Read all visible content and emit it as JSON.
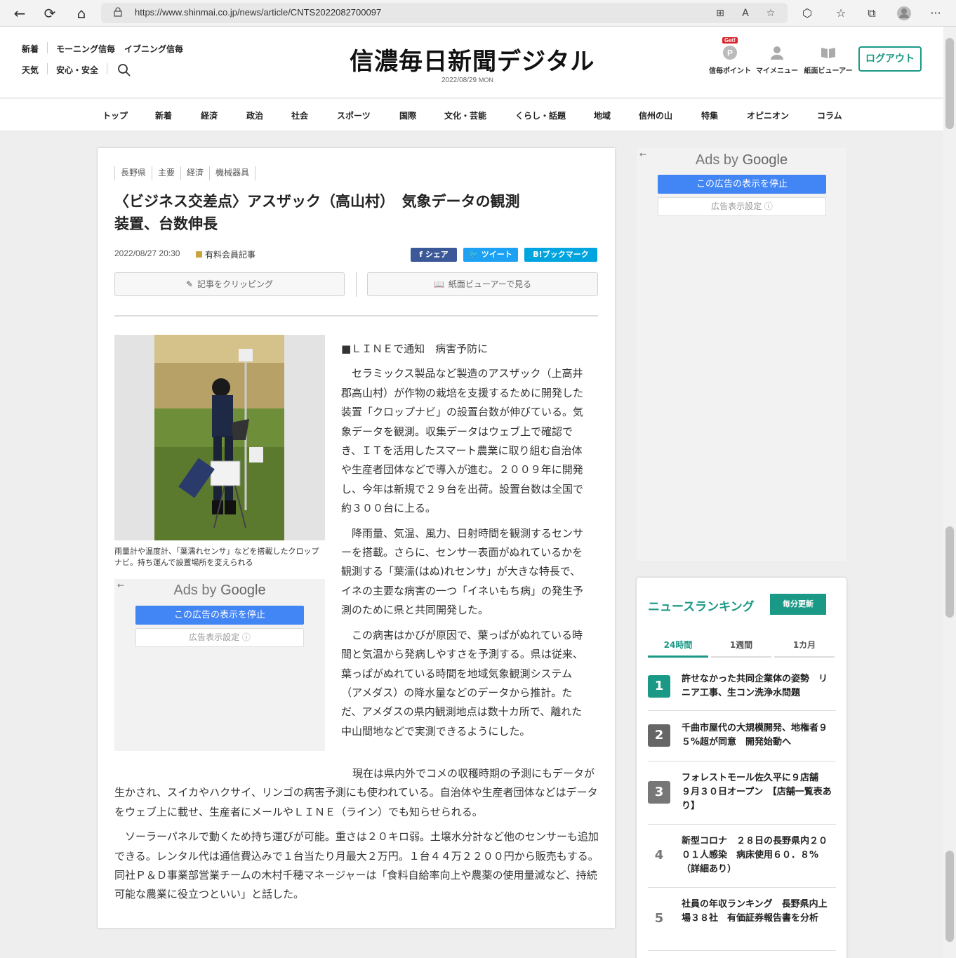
{
  "browser": {
    "url": "https://www.shinmai.co.jp/news/article/CNTS2022082700097",
    "back_icon": "←",
    "reload_icon": "⟳",
    "home_icon": "⌂",
    "more_icon": "···"
  },
  "header": {
    "left_links_row1": [
      "新着",
      "モーニング信毎",
      "イブニング信毎"
    ],
    "left_links_row2": [
      "天気",
      "安心・安全"
    ],
    "logo": "信濃毎日新聞デジタル",
    "date": "2022/08/29",
    "day": "MON",
    "get_badge": "Get!",
    "icons": [
      {
        "label": "信毎ポイント"
      },
      {
        "label": "マイメニュー"
      },
      {
        "label": "紙面ビューアー"
      }
    ],
    "logout": "ログアウト"
  },
  "nav": [
    "トップ",
    "新着",
    "経済",
    "政治",
    "社会",
    "スポーツ",
    "国際",
    "文化・芸能",
    "くらし・話題",
    "地域",
    "信州の山",
    "特集",
    "オピニオン",
    "コラム"
  ],
  "article": {
    "tags": [
      "長野県",
      "主要",
      "経済",
      "機械器具"
    ],
    "headline_line1": "〈ビジネス交差点〉アスザック（高山村）　気象データの観測",
    "headline_line2": "装置、台数伸長",
    "datetime": "2022/08/27 20:30",
    "paid_label": "有料会員記事",
    "share": {
      "facebook": "シェア",
      "twitter": "ツイート",
      "hatena": "ブックマーク",
      "hatena_mark": "B!"
    },
    "clip_button": "記事をクリッピング",
    "viewer_button": "紙面ビューアーで見る",
    "photo_caption": "雨量計や温度計、「葉濡れセンサ」などを搭載したクロップナビ。持ち運んで設置場所を変えられる",
    "lead": "■ＬＩＮＥで通知　病害予防に",
    "p1": "セラミックス製品など製造のアスザック（上高井郡高山村）が作物の栽培を支援するために開発した装置「クロップナビ」の設置台数が伸びている。気象データを観測。収集データはウェブ上で確認でき、ＩＴを活用したスマート農業に取り組む自治体や生産者団体などで導入が進む。２００９年に開発し、今年は新規で２９台を出荷。設置台数は全国で約３００台に上る。",
    "p2": "降雨量、気温、風力、日射時間を観測するセンサーを搭載。さらに、センサー表面がぬれているかを観測する「葉濡(はぬ)れセンサ」が大きな特長で、イネの主要な病害の一つ「イネいもち病」の発生予測のために県と共同開発した。",
    "p3": "この病害はかびが原因で、葉っぱがぬれている時間と気温から発病しやすさを予測する。県は従来、葉っぱがぬれている時間を地域気象観測システム（アメダス）の降水量などのデータから推計。ただ、アメダスの県内観測地点は数十カ所で、離れた中山間地などで実測できるようにした。",
    "p4_start": "現在は県内外でコメの収穫時期の予測にもデー",
    "p4_rest": "タが生かされ、スイカやハクサイ、リンゴの病害予測にも使われている。自治体や生産者団体などはデータをウェブ上に載せ、生産者にメールやＬＩＮＥ（ライン）でも知らせられる。",
    "p5": "ソーラーパネルで動くため持ち運びが可能。重さは２０キロ弱。土壌水分計など他のセンサーも追加できる。レンタル代は通信費込みで１台当たり月最大２万円。１台４４万２２００円から販売もする。同社Ｐ＆Ｄ事業部営業チームの木村千穂マネージャーは「食料自給率向上や農薬の使用量減など、持続可能な農業に役立つといい」と話した。"
  },
  "ads": {
    "ads_by": "Ads by",
    "google": "Google",
    "stop_button": "この広告の表示を停止",
    "settings_button": "広告表示設定 ⓘ",
    "back_arrow": "←"
  },
  "ranking": {
    "title": "ニュースランキング",
    "badge": "毎分更新",
    "tabs": [
      "24時間",
      "1週間",
      "1カ月"
    ],
    "items": [
      {
        "rank": "1",
        "text": "許せなかった共同企業体の姿勢　リニア工事、生コン洗浄水問題"
      },
      {
        "rank": "2",
        "text": "千曲市屋代の大規模開発、地権者９５%超が同意　開発始動へ"
      },
      {
        "rank": "3",
        "text": "フォレストモール佐久平に９店舗　９月３０日オープン　【店舗一覧表あり】"
      },
      {
        "rank": "4",
        "text": "新型コロナ　２８日の長野県内２００１人感染　病床使用６０．８%（詳細あり）"
      },
      {
        "rank": "5",
        "text": "社員の年収ランキング　長野県内上場３８社　有価証券報告書を分析"
      }
    ]
  },
  "colors": {
    "accent": "#1a9a86",
    "facebook": "#3b5998",
    "twitter": "#1da1f2",
    "hatena": "#00a4de",
    "ad_blue": "#4285f4"
  }
}
